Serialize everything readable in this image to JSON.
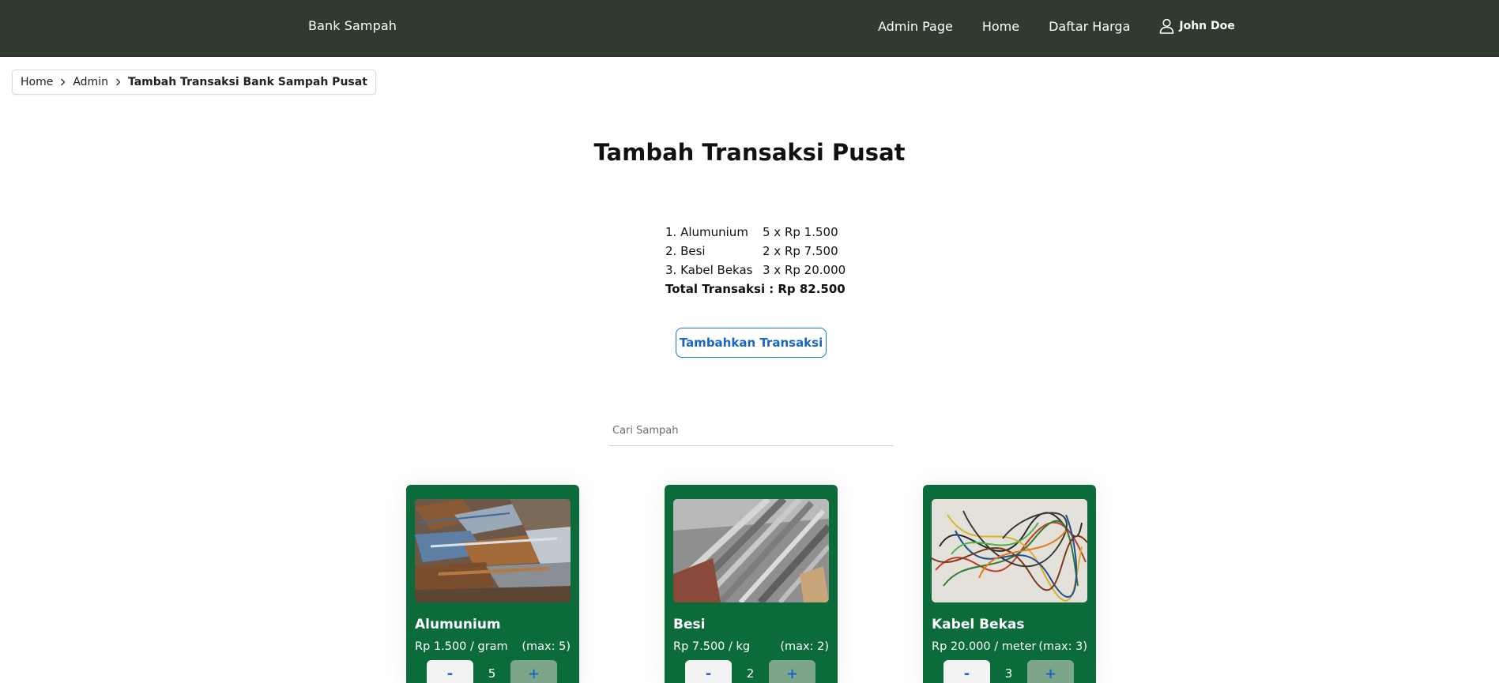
{
  "navbar": {
    "brand": "Bank Sampah",
    "links": [
      "Admin Page",
      "Home",
      "Daftar Harga"
    ],
    "user": "John Doe",
    "bg_color": "#2f3b2f"
  },
  "breadcrumb": [
    "Home",
    "Admin",
    "Tambah Transaksi Bank Sampah Pusat"
  ],
  "page_title": "Tambah Transaksi Pusat",
  "summary": {
    "items": [
      {
        "name": "1. Alumunium",
        "qty": "5 x Rp 1.500"
      },
      {
        "name": "2. Besi",
        "qty": "2 x Rp 7.500"
      },
      {
        "name": "3. Kabel Bekas",
        "qty": "3 x Rp 20.000"
      }
    ],
    "total_label": "Total Transaksi :",
    "total_value": "Rp 82.500"
  },
  "add_button": "Tambahkan Transaksi",
  "search": {
    "placeholder": "Cari Sampah",
    "value": ""
  },
  "cards": [
    {
      "name": "Alumunium",
      "price": "Rp 1.500 / gram",
      "max": "(max: 5)",
      "minus": "-",
      "plus": "+",
      "quantity": "5",
      "image": "aluminium-scrap-photo"
    },
    {
      "name": "Besi",
      "price": "Rp 7.500 / kg",
      "max": "(max: 2)",
      "minus": "-",
      "plus": "+",
      "quantity": "2",
      "image": "iron-bars-photo"
    },
    {
      "name": "Kabel Bekas",
      "price": "Rp 20.000 / meter",
      "max": "(max: 3)",
      "minus": "-",
      "plus": "+",
      "quantity": "3",
      "image": "tangled-cables-photo"
    }
  ],
  "colors": {
    "card_bg": "#0b6b3a",
    "accent": "#1a66c4",
    "plus_bg": "#7ca58a"
  }
}
